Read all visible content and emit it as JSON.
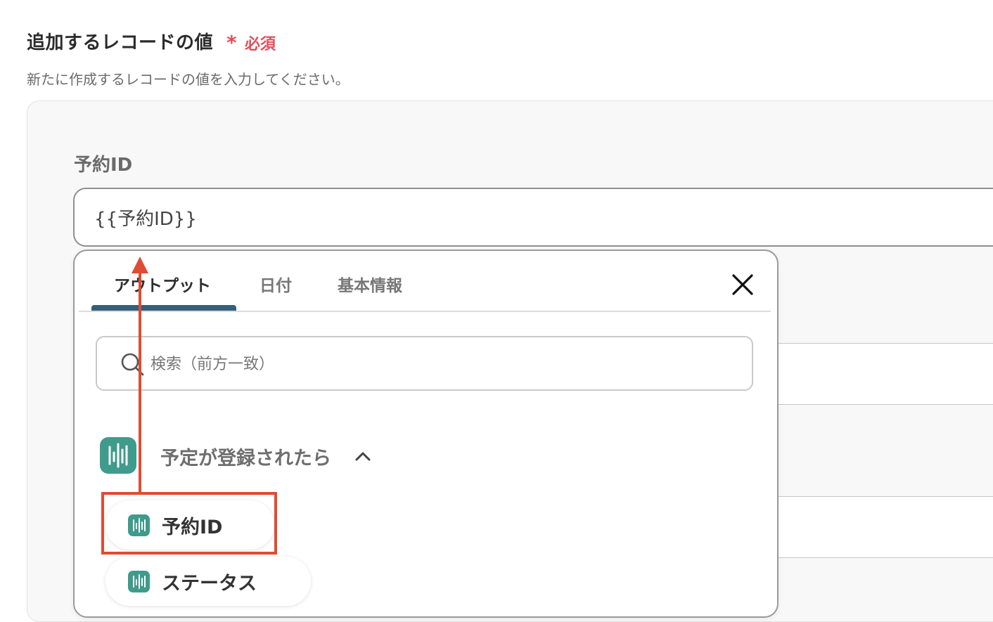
{
  "section": {
    "title": "追加するレコードの値",
    "required_star": "*",
    "required_label": "必須",
    "description": "新たに作成するレコードの値を入力してください。"
  },
  "field": {
    "label": "予約ID",
    "value": "{{予約ID}}"
  },
  "dropdown": {
    "tabs": [
      {
        "label": "アウトプット",
        "active": true
      },
      {
        "label": "日付",
        "active": false
      },
      {
        "label": "基本情報",
        "active": false
      }
    ],
    "search_placeholder": "検索（前方一致）",
    "group": {
      "title": "予定が登録されたら",
      "items": [
        "予約ID",
        "ステータス"
      ]
    }
  },
  "colors": {
    "required": "#e0505d",
    "tab_underline": "#355f79",
    "app_icon": "#3f9b8c",
    "annotation": "#e04b34"
  },
  "icons": {
    "close": "close-icon",
    "search": "search-icon",
    "chevron": "chevron-up-icon",
    "app": "app-logo-icon"
  }
}
